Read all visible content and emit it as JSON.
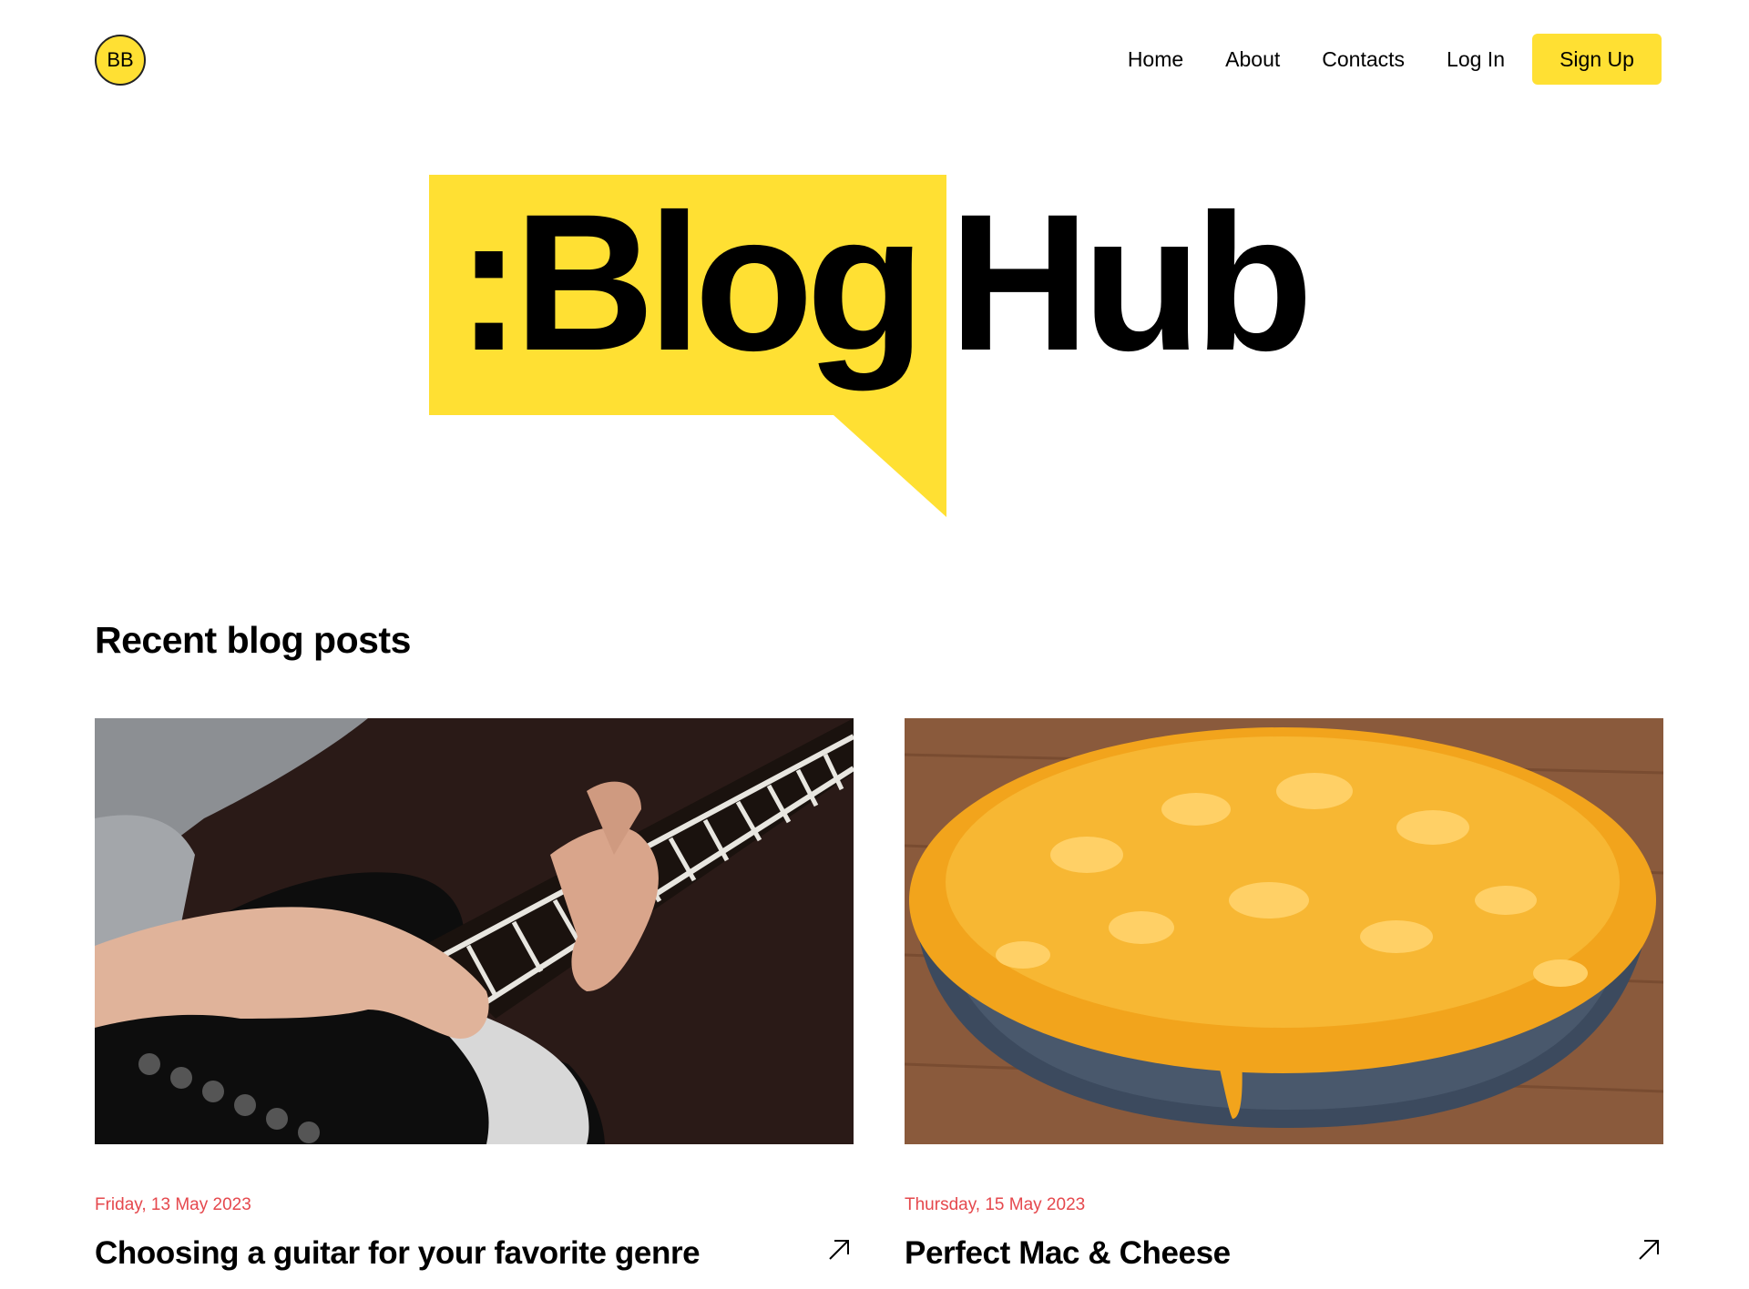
{
  "header": {
    "avatar_initials": "BB",
    "nav": {
      "home": "Home",
      "about": "About",
      "contacts": "Contacts",
      "login": "Log In",
      "signup": "Sign Up"
    }
  },
  "logo": {
    "part1": ":Blog",
    "part2": "Hub"
  },
  "section": {
    "title": "Recent blog posts"
  },
  "posts": [
    {
      "date": "Friday, 13 May 2023",
      "title": "Choosing a guitar for your favorite genre"
    },
    {
      "date": "Thursday, 15 May 2023",
      "title": "Perfect Mac & Cheese"
    }
  ],
  "colors": {
    "accent": "#FFE033",
    "date": "#E5484D"
  },
  "icons": {
    "post_link": "arrow-up-right-icon"
  }
}
